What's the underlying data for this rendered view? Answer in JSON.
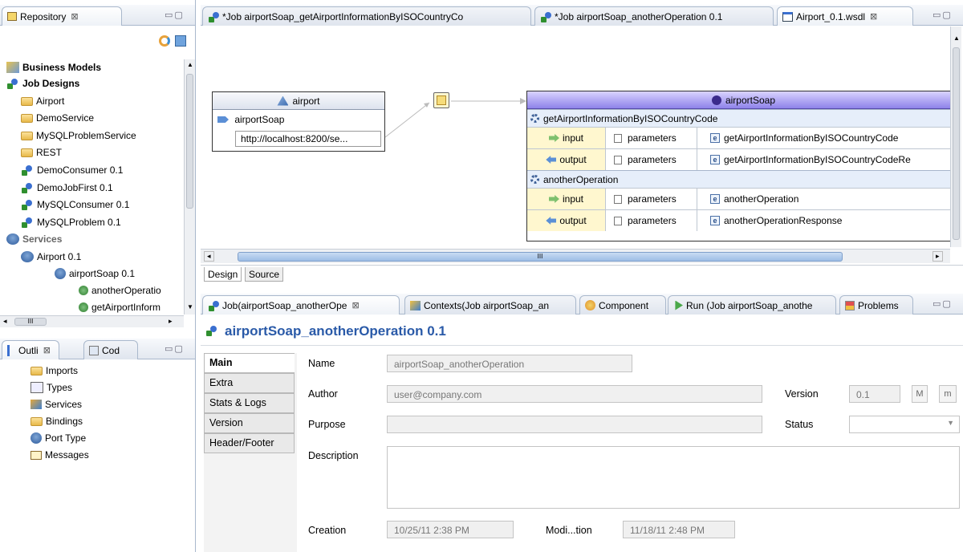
{
  "repository": {
    "tab_label": "Repository",
    "items": [
      {
        "label": "Business Models"
      },
      {
        "label": "Job Designs"
      },
      {
        "label": "Airport"
      },
      {
        "label": "DemoService"
      },
      {
        "label": "MySQLProblemService"
      },
      {
        "label": "REST"
      },
      {
        "label": "DemoConsumer 0.1"
      },
      {
        "label": "DemoJobFirst 0.1"
      },
      {
        "label": "MySQLConsumer 0.1"
      },
      {
        "label": "MySQLProblem 0.1"
      },
      {
        "label": "Services"
      },
      {
        "label": "Airport 0.1"
      },
      {
        "label": "airportSoap 0.1"
      },
      {
        "label": "anotherOperatio"
      },
      {
        "label": "getAirportInform"
      }
    ],
    "hscroll_label": "III"
  },
  "outline": {
    "tab_outline": "Outli",
    "tab_code": "Cod",
    "items": [
      {
        "label": "Imports"
      },
      {
        "label": "Types"
      },
      {
        "label": "Services"
      },
      {
        "label": "Bindings"
      },
      {
        "label": "Port Type"
      },
      {
        "label": "Messages"
      }
    ]
  },
  "editor": {
    "tabs": [
      {
        "label": "*Job airportSoap_getAirportInformationByISOCountryCo"
      },
      {
        "label": "*Job airportSoap_anotherOperation 0.1"
      },
      {
        "label": "Airport_0.1.wsdl"
      }
    ],
    "service_box": {
      "title": "airport",
      "port": "airportSoap",
      "address": "http://localhost:8200/se..."
    },
    "binding_box": {
      "title": "airportSoap",
      "operations": [
        {
          "name": "getAirportInformationByISOCountryCode",
          "messages": [
            {
              "dir": "input",
              "param": "parameters",
              "element": "getAirportInformationByISOCountryCode"
            },
            {
              "dir": "output",
              "param": "parameters",
              "element": "getAirportInformationByISOCountryCodeRe"
            }
          ]
        },
        {
          "name": "anotherOperation",
          "messages": [
            {
              "dir": "input",
              "param": "parameters",
              "element": "anotherOperation"
            },
            {
              "dir": "output",
              "param": "parameters",
              "element": "anotherOperationResponse"
            }
          ]
        }
      ]
    },
    "hscroll_label": "III",
    "bottom_tabs": {
      "design": "Design",
      "source": "Source"
    }
  },
  "bottom_panel": {
    "tabs": [
      {
        "label": "Job(airportSoap_anotherOpe"
      },
      {
        "label": "Contexts(Job airportSoap_an"
      },
      {
        "label": "Component"
      },
      {
        "label": "Run (Job airportSoap_anothe"
      },
      {
        "label": "Problems"
      }
    ],
    "title": "airportSoap_anotherOperation 0.1",
    "side_tabs": [
      {
        "label": "Main"
      },
      {
        "label": "Extra"
      },
      {
        "label": "Stats & Logs"
      },
      {
        "label": "Version"
      },
      {
        "label": "Header/Footer"
      }
    ],
    "form": {
      "name_label": "Name",
      "name_value": "airportSoap_anotherOperation",
      "author_label": "Author",
      "author_value": "user@company.com",
      "version_label": "Version",
      "version_value": "0.1",
      "btn_m_upper": "M",
      "btn_m_lower": "m",
      "purpose_label": "Purpose",
      "purpose_value": "",
      "status_label": "Status",
      "status_value": "",
      "description_label": "Description",
      "description_value": "",
      "creation_label": "Creation",
      "creation_value": "10/25/11 2:38 PM",
      "modification_label": "Modi...tion",
      "modification_value": "11/18/11 2:48 PM"
    }
  },
  "colors": {
    "accent": "#2a5aa8",
    "soap_header": "#8e82ea",
    "tab_border": "#a9b8cc"
  }
}
